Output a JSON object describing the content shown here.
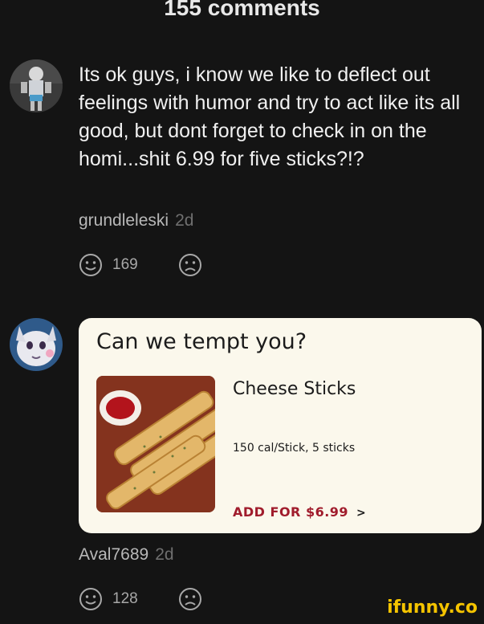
{
  "header": {
    "title": "155 comments"
  },
  "comments": [
    {
      "text": "Its ok guys, i know we like to deflect out feelings with humor and try to act like its all good, but dont forget to check in on the homi...shit 6.99 for five sticks?!?",
      "username": "grundleleski",
      "time": "2d",
      "likes": "169",
      "avatar_icon": "avatar-character-icon"
    },
    {
      "username": "Aval7689",
      "time": "2d",
      "likes": "128",
      "avatar_icon": "avatar-furry-icon",
      "image_card": {
        "title": "Can we tempt you?",
        "item_name": "Cheese Sticks",
        "item_info": "150 cal/Stick, 5 sticks",
        "button_label": "ADD FOR $6.99",
        "button_arrow": ">",
        "accent_color": "#a01c2c"
      }
    }
  ],
  "watermark": "ifunny.co",
  "icons": {
    "like": "smile-icon",
    "dislike": "frown-icon"
  }
}
